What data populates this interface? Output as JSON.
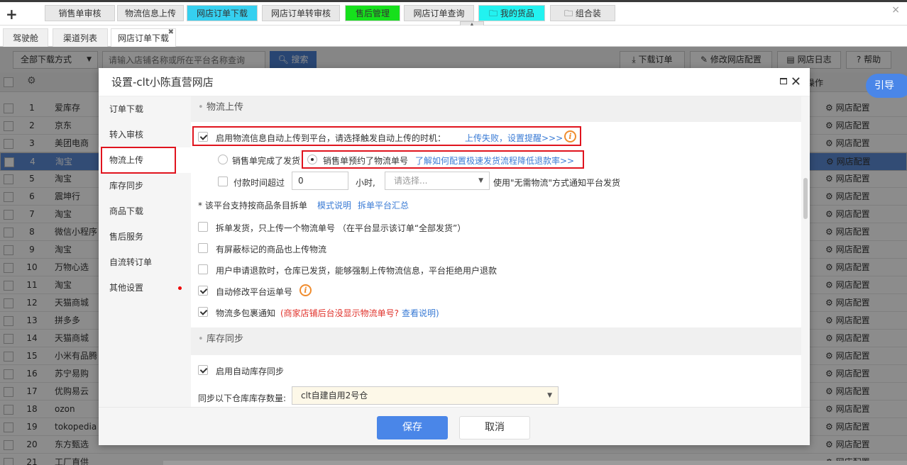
{
  "top_tabs": [
    {
      "label": "销售单审核",
      "bg": "#e8e8e8"
    },
    {
      "label": "物流信息上传",
      "bg": "#e8e8e8"
    },
    {
      "label": "网店订单下载",
      "bg": "#35d0f0"
    },
    {
      "label": "网店订单转审核",
      "bg": "#e8e8e8"
    },
    {
      "label": "售后管理",
      "bg": "#16e01c"
    },
    {
      "label": "网店订单查询",
      "bg": "#e8e8e8"
    },
    {
      "label": "我的货品",
      "bg": "#22f2f0"
    },
    {
      "label": "组合装",
      "bg": "#e8e8e8"
    }
  ],
  "top_plus": "+",
  "top_close": "×",
  "secondary_tabs": [
    "驾驶舱",
    "渠道列表",
    "网店订单下载"
  ],
  "toolbar": {
    "download_mode": "全部下载方式",
    "search_placeholder": "请输入店铺名称或所在平台名称查询",
    "search_label": "搜索",
    "download_orders": "下载订单",
    "edit_shop_config": "修改网店配置",
    "shop_log": "网店日志",
    "help": "帮助"
  },
  "grid": {
    "op_header": "操作",
    "config_label": "网店配置",
    "rows": [
      {
        "num": "1",
        "shop": "爱库存"
      },
      {
        "num": "2",
        "shop": "京东"
      },
      {
        "num": "3",
        "shop": "美团电商"
      },
      {
        "num": "4",
        "shop": "淘宝"
      },
      {
        "num": "5",
        "shop": "淘宝"
      },
      {
        "num": "6",
        "shop": "震坤行"
      },
      {
        "num": "7",
        "shop": "淘宝"
      },
      {
        "num": "8",
        "shop": "微信小程序"
      },
      {
        "num": "9",
        "shop": "淘宝"
      },
      {
        "num": "10",
        "shop": "万物心选"
      },
      {
        "num": "11",
        "shop": "淘宝"
      },
      {
        "num": "12",
        "shop": "天猫商城"
      },
      {
        "num": "13",
        "shop": "拼多多"
      },
      {
        "num": "14",
        "shop": "天猫商城"
      },
      {
        "num": "15",
        "shop": "小米有品腾"
      },
      {
        "num": "16",
        "shop": "苏宁易购"
      },
      {
        "num": "17",
        "shop": "优购易云"
      },
      {
        "num": "18",
        "shop": "ozon"
      },
      {
        "num": "19",
        "shop": "tokopedia"
      },
      {
        "num": "20",
        "shop": "东方甄选"
      },
      {
        "num": "21",
        "shop": "工厂直供"
      }
    ]
  },
  "guide_label": "引导",
  "modal": {
    "title": "设置-clt小陈直营网店",
    "nav": [
      "订单下载",
      "转入审核",
      "物流上传",
      "库存同步",
      "商品下载",
      "售后服务",
      "自流转订单",
      "其他设置"
    ],
    "logistics": {
      "section_title": "物流上传",
      "enable_label": "启用物流信息自动上传到平台，请选择触发自动上传的时机：",
      "fail_link": "上传失败，设置提醒>>>",
      "radio1": "销售单完成了发货",
      "radio2": "销售单预约了物流单号",
      "config_link": "了解如何配置极速发货流程降低退款率>>",
      "pay_over": "付款时间超过",
      "hours_value": "0",
      "hours_unit": "小时,",
      "select_placeholder": "请选择...",
      "notify_text": "使用\"无需物流\"方式通知平台发货",
      "split_note": "* 该平台支持按商品条目拆单",
      "mode_link": "模式说明",
      "split_summary_link": "拆单平台汇总",
      "opt1": "拆单发货，只上传一个物流单号 （在平台显示该订单“全部发货”）",
      "opt2": "有屏蔽标记的商品也上传物流",
      "opt3": "用户申请退款时，仓库已发货，能够强制上传物流信息，平台拒绝用户退款",
      "opt4": "自动修改平台运单号",
      "opt5": "物流多包裹通知",
      "opt5_warn": "(商家店铺后台没显示物流单号?",
      "opt5_link": "查看说明)"
    },
    "stock": {
      "section_title": "库存同步",
      "enable_label": "启用自动库存同步",
      "warehouse_label": "同步以下仓库库存数量:",
      "warehouse_value": "clt自建自用2号仓"
    },
    "save": "保存",
    "cancel": "取消"
  }
}
